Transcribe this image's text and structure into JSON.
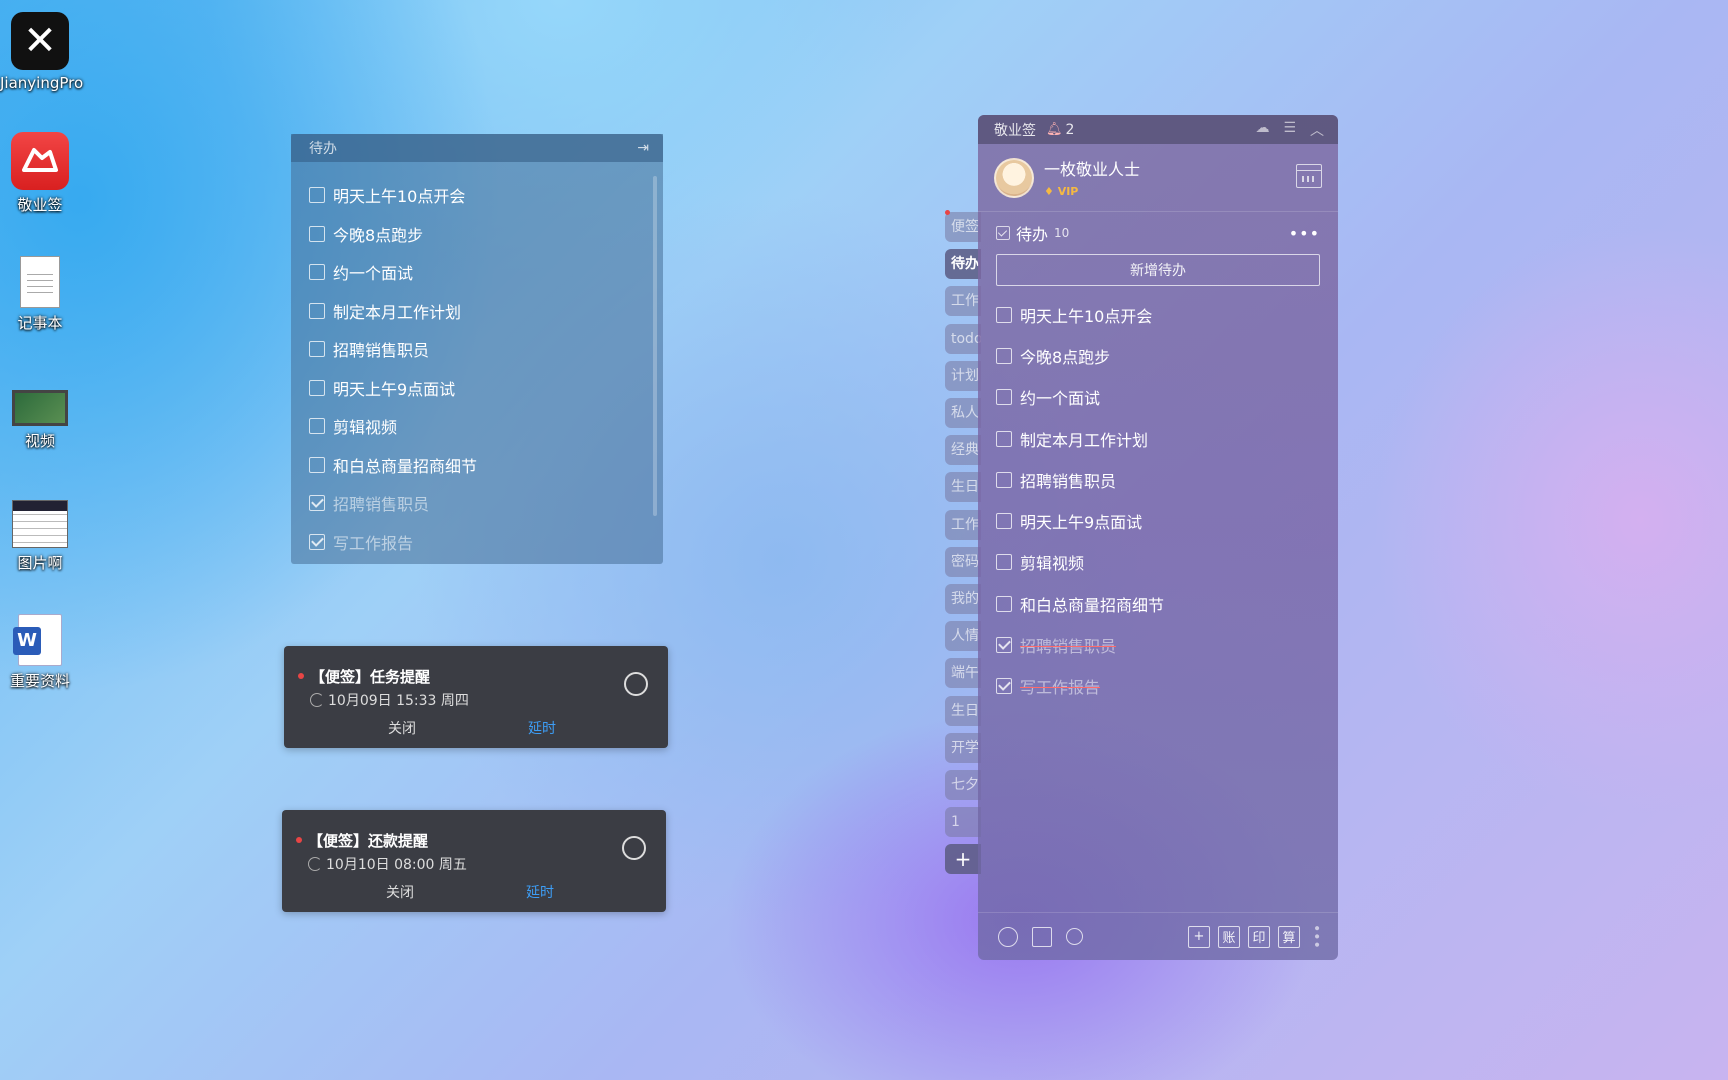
{
  "desktop": {
    "icons": [
      {
        "label": "JianyingPro",
        "icon": "capcut-icon"
      },
      {
        "label": "敬业签",
        "icon": "jingyeqian-icon"
      },
      {
        "label": "记事本",
        "icon": "notepad-icon"
      },
      {
        "label": "视频",
        "icon": "video-icon"
      },
      {
        "label": "图片啊",
        "icon": "image-icon"
      },
      {
        "label": "重要资料",
        "icon": "word-icon"
      }
    ]
  },
  "sticky": {
    "title": "待办",
    "items": [
      {
        "text": "明天上午10点开会",
        "done": false
      },
      {
        "text": "今晚8点跑步",
        "done": false
      },
      {
        "text": "约一个面试",
        "done": false
      },
      {
        "text": "制定本月工作计划",
        "done": false
      },
      {
        "text": "招聘销售职员",
        "done": false
      },
      {
        "text": "明天上午9点面试",
        "done": false
      },
      {
        "text": "剪辑视频",
        "done": false
      },
      {
        "text": "和白总商量招商细节",
        "done": false
      },
      {
        "text": "招聘销售职员",
        "done": true
      },
      {
        "text": "写工作报告",
        "done": true
      }
    ]
  },
  "reminders": [
    {
      "title": "【便签】任务提醒",
      "time": "10月09日 15:33 周四",
      "close": "关闭",
      "delay": "延时"
    },
    {
      "title": "【便签】还款提醒",
      "time": "10月10日 08:00 周五",
      "close": "关闭",
      "delay": "延时"
    }
  ],
  "tabs": [
    "便签",
    "待办",
    "工作",
    "todo",
    "计划",
    "私人",
    "经典",
    "生日",
    "工作",
    "密码",
    "我的",
    "人情",
    "端午",
    "生日",
    "开学",
    "七夕",
    "1",
    "+"
  ],
  "active_tab": "待办",
  "app": {
    "name": "敬业签",
    "notify_count": "2",
    "user": {
      "name": "一枚敬业人士",
      "vip": "VIP"
    },
    "section": {
      "title": "待办",
      "count": "10",
      "more": "•••"
    },
    "add_label": "新增待办",
    "items": [
      {
        "text": "明天上午10点开会",
        "done": false
      },
      {
        "text": "今晚8点跑步",
        "done": false
      },
      {
        "text": "约一个面试",
        "done": false
      },
      {
        "text": "制定本月工作计划",
        "done": false
      },
      {
        "text": "招聘销售职员",
        "done": false
      },
      {
        "text": "明天上午9点面试",
        "done": false
      },
      {
        "text": "剪辑视频",
        "done": false
      },
      {
        "text": "和白总商量招商细节",
        "done": false
      },
      {
        "text": "招聘销售职员",
        "done": true
      },
      {
        "text": "写工作报告",
        "done": true
      }
    ],
    "footer": {
      "b1": "+",
      "b2": "账",
      "b3": "印",
      "b4": "算"
    }
  }
}
